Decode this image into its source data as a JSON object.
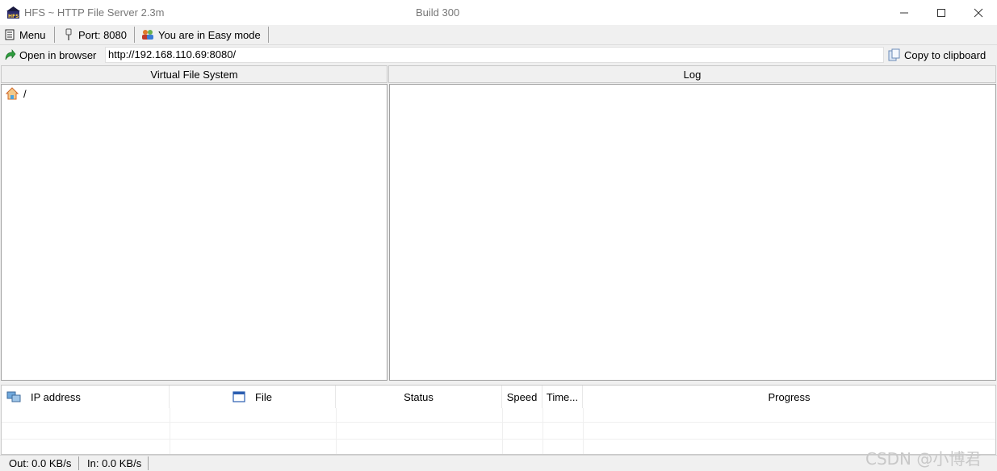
{
  "window": {
    "title": "HFS ~ HTTP File Server 2.3m",
    "build": "Build 300"
  },
  "toolbar": {
    "menu_label": "Menu",
    "port_label": "Port: 8080",
    "mode_label": "You are in Easy mode"
  },
  "urlbar": {
    "open_browser_label": "Open in browser",
    "url": "http://192.168.110.69:8080/",
    "copy_label": "Copy to clipboard"
  },
  "panels": {
    "vfs_title": "Virtual File System",
    "log_title": "Log",
    "root_item": "/"
  },
  "connections": {
    "columns": [
      "IP address",
      "File",
      "Status",
      "Speed",
      "Time...",
      "Progress"
    ]
  },
  "statusbar": {
    "out": "Out: 0.0 KB/s",
    "in": "In: 0.0 KB/s"
  },
  "watermark": "CSDN @小博君",
  "icons": {
    "app": "hfs-icon",
    "menu": "menu-icon",
    "port": "plug-icon",
    "mode": "users-icon",
    "open_browser": "green-arrow-icon",
    "copy": "clipboard-icon",
    "root": "home-icon",
    "ip": "network-icon",
    "file": "window-icon"
  }
}
